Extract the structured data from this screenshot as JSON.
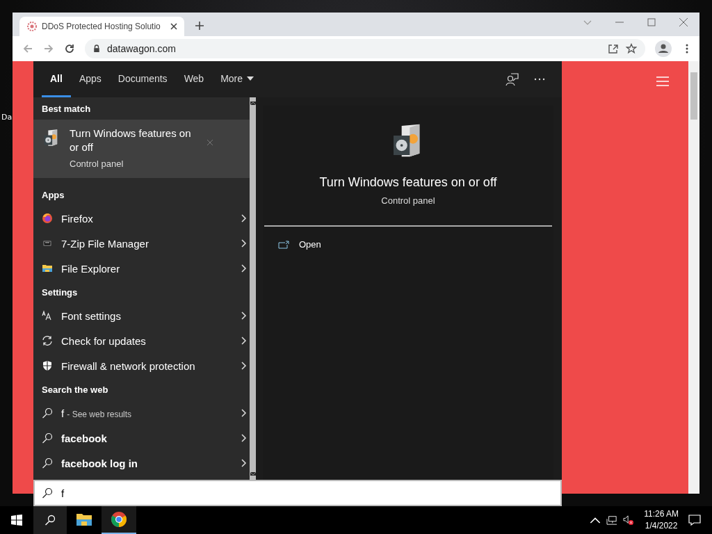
{
  "desktop": {
    "icon_labels": [
      "Da"
    ]
  },
  "browser": {
    "tabs": [
      {
        "title": "DDoS Protected Hosting Solutio",
        "selected": true
      }
    ],
    "address": "datawagon.com"
  },
  "search": {
    "tabs": [
      {
        "label": "All",
        "selected": true,
        "kind": "plain"
      },
      {
        "label": "Apps",
        "selected": false,
        "kind": "plain"
      },
      {
        "label": "Documents",
        "selected": false,
        "kind": "plain"
      },
      {
        "label": "Web",
        "selected": false,
        "kind": "plain"
      },
      {
        "label": "More",
        "selected": false,
        "kind": "dropdown"
      }
    ],
    "best_match": {
      "heading": "Best match",
      "title": "Turn Windows features on or off",
      "subtitle": "Control panel",
      "selected": true
    },
    "sections": [
      {
        "heading": "Apps",
        "items": [
          {
            "kind": "browser",
            "label": "Firefox"
          },
          {
            "kind": "archiver",
            "label": "7-Zip File Manager"
          },
          {
            "kind": "folder",
            "label": "File Explorer"
          }
        ]
      },
      {
        "heading": "Settings",
        "items": [
          {
            "kind": "font",
            "label": "Font settings"
          },
          {
            "kind": "update",
            "label": "Check for updates"
          },
          {
            "kind": "shield",
            "label": "Firewall & network protection"
          }
        ]
      },
      {
        "heading": "Search the web",
        "items": [
          {
            "kind": "hint",
            "label": "f",
            "note": "- See web results"
          },
          {
            "kind": "suggestion",
            "label": "facebook"
          },
          {
            "kind": "suggestion",
            "label": "facebook log in"
          }
        ]
      }
    ],
    "preview": {
      "title": "Turn Windows features on or off",
      "subtitle": "Control panel",
      "actions": [
        {
          "label": "Open"
        }
      ]
    },
    "query": "f"
  },
  "taskbar": {
    "apps": [
      {
        "kind": "folder",
        "selected": false
      },
      {
        "kind": "chrome",
        "selected": true
      }
    ],
    "time": "11:26 AM",
    "date": "1/4/2022"
  }
}
